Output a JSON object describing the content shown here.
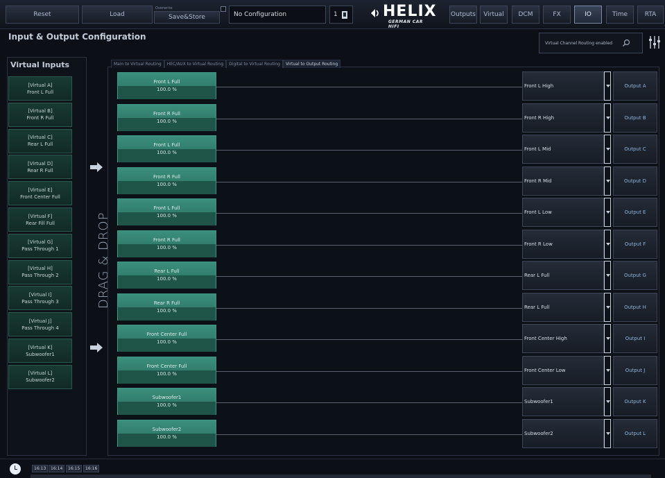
{
  "toolbar": {
    "reset": "Reset",
    "load": "Load",
    "preset_small": "Overwrite",
    "save_store": "Save&Store",
    "config_name": "No Configuration",
    "slot": "1",
    "nav": [
      "Outputs",
      "Virtual",
      "DCM",
      "FX",
      "IO",
      "Time",
      "RTA"
    ],
    "active_nav": "IO"
  },
  "logo": {
    "name": "HELIX",
    "sub": "GERMAN CAR HIFI"
  },
  "page_title": "Input & Output Configuration",
  "routing_toggle": "Virtual Channel Routing enabled",
  "virtual_inputs": {
    "title": "Virtual Inputs",
    "items": [
      {
        "id": "[Virtual A]",
        "label": "Front L Full"
      },
      {
        "id": "[Virtual B]",
        "label": "Front R Full"
      },
      {
        "id": "[Virtual C]",
        "label": "Rear L Full"
      },
      {
        "id": "[Virtual D]",
        "label": "Rear R Full"
      },
      {
        "id": "[Virtual E]",
        "label": "Front Center Full"
      },
      {
        "id": "[Virtual F]",
        "label": "Rear Fill Full"
      },
      {
        "id": "[Virtual G]",
        "label": "Pass Through 1"
      },
      {
        "id": "[Virtual H]",
        "label": "Pass Through 2"
      },
      {
        "id": "[Virtual I]",
        "label": "Pass Through 3"
      },
      {
        "id": "[Virtual J]",
        "label": "Pass Through 4"
      },
      {
        "id": "[Virtual K]",
        "label": "Subwoofer1"
      },
      {
        "id": "[Virtual L]",
        "label": "Subwoofer2"
      }
    ]
  },
  "drag_drop": "DRAG & DROP",
  "tabs": [
    "Main to Virtual Routing",
    "HEC/AUX to Virtual Routing",
    "Digital to Virtual Routing",
    "Virtual to Output Routing"
  ],
  "active_tab": "Virtual to Output Routing",
  "routes": [
    {
      "source": "Front L Full",
      "level": "100.0 %",
      "channel": "Front L High",
      "output": "Output A"
    },
    {
      "source": "Front R Full",
      "level": "100.0 %",
      "channel": "Front R High",
      "output": "Output B"
    },
    {
      "source": "Front L Full",
      "level": "100.0 %",
      "channel": "Front L Mid",
      "output": "Output C"
    },
    {
      "source": "Front R Full",
      "level": "100.0 %",
      "channel": "Front R Mid",
      "output": "Output D"
    },
    {
      "source": "Front L Full",
      "level": "100.0 %",
      "channel": "Front L Low",
      "output": "Output E"
    },
    {
      "source": "Front R Full",
      "level": "100.0 %",
      "channel": "Front R Low",
      "output": "Output F"
    },
    {
      "source": "Rear L Full",
      "level": "100.0 %",
      "channel": "Rear L Full",
      "output": "Output G"
    },
    {
      "source": "Rear R Full",
      "level": "100.0 %",
      "channel": "Rear L Full",
      "output": "Output H"
    },
    {
      "source": "Front Center Full",
      "level": "100.0 %",
      "channel": "Front Center High",
      "output": "Output I"
    },
    {
      "source": "Front Center Full",
      "level": "100.0 %",
      "channel": "Front Center Low",
      "output": "Output J"
    },
    {
      "source": "Subwoofer1",
      "level": "100.0 %",
      "channel": "Subwoofer1",
      "output": "Output K"
    },
    {
      "source": "Subwoofer2",
      "level": "100.0 %",
      "channel": "Subwoofer2",
      "output": "Output L"
    }
  ],
  "timeline": [
    "16:13",
    "16:14",
    "16:15",
    "16:16"
  ],
  "colors": {
    "accent_green": "#3b8f7c",
    "output_text": "#8fb6de",
    "background": "#0c0f16"
  }
}
